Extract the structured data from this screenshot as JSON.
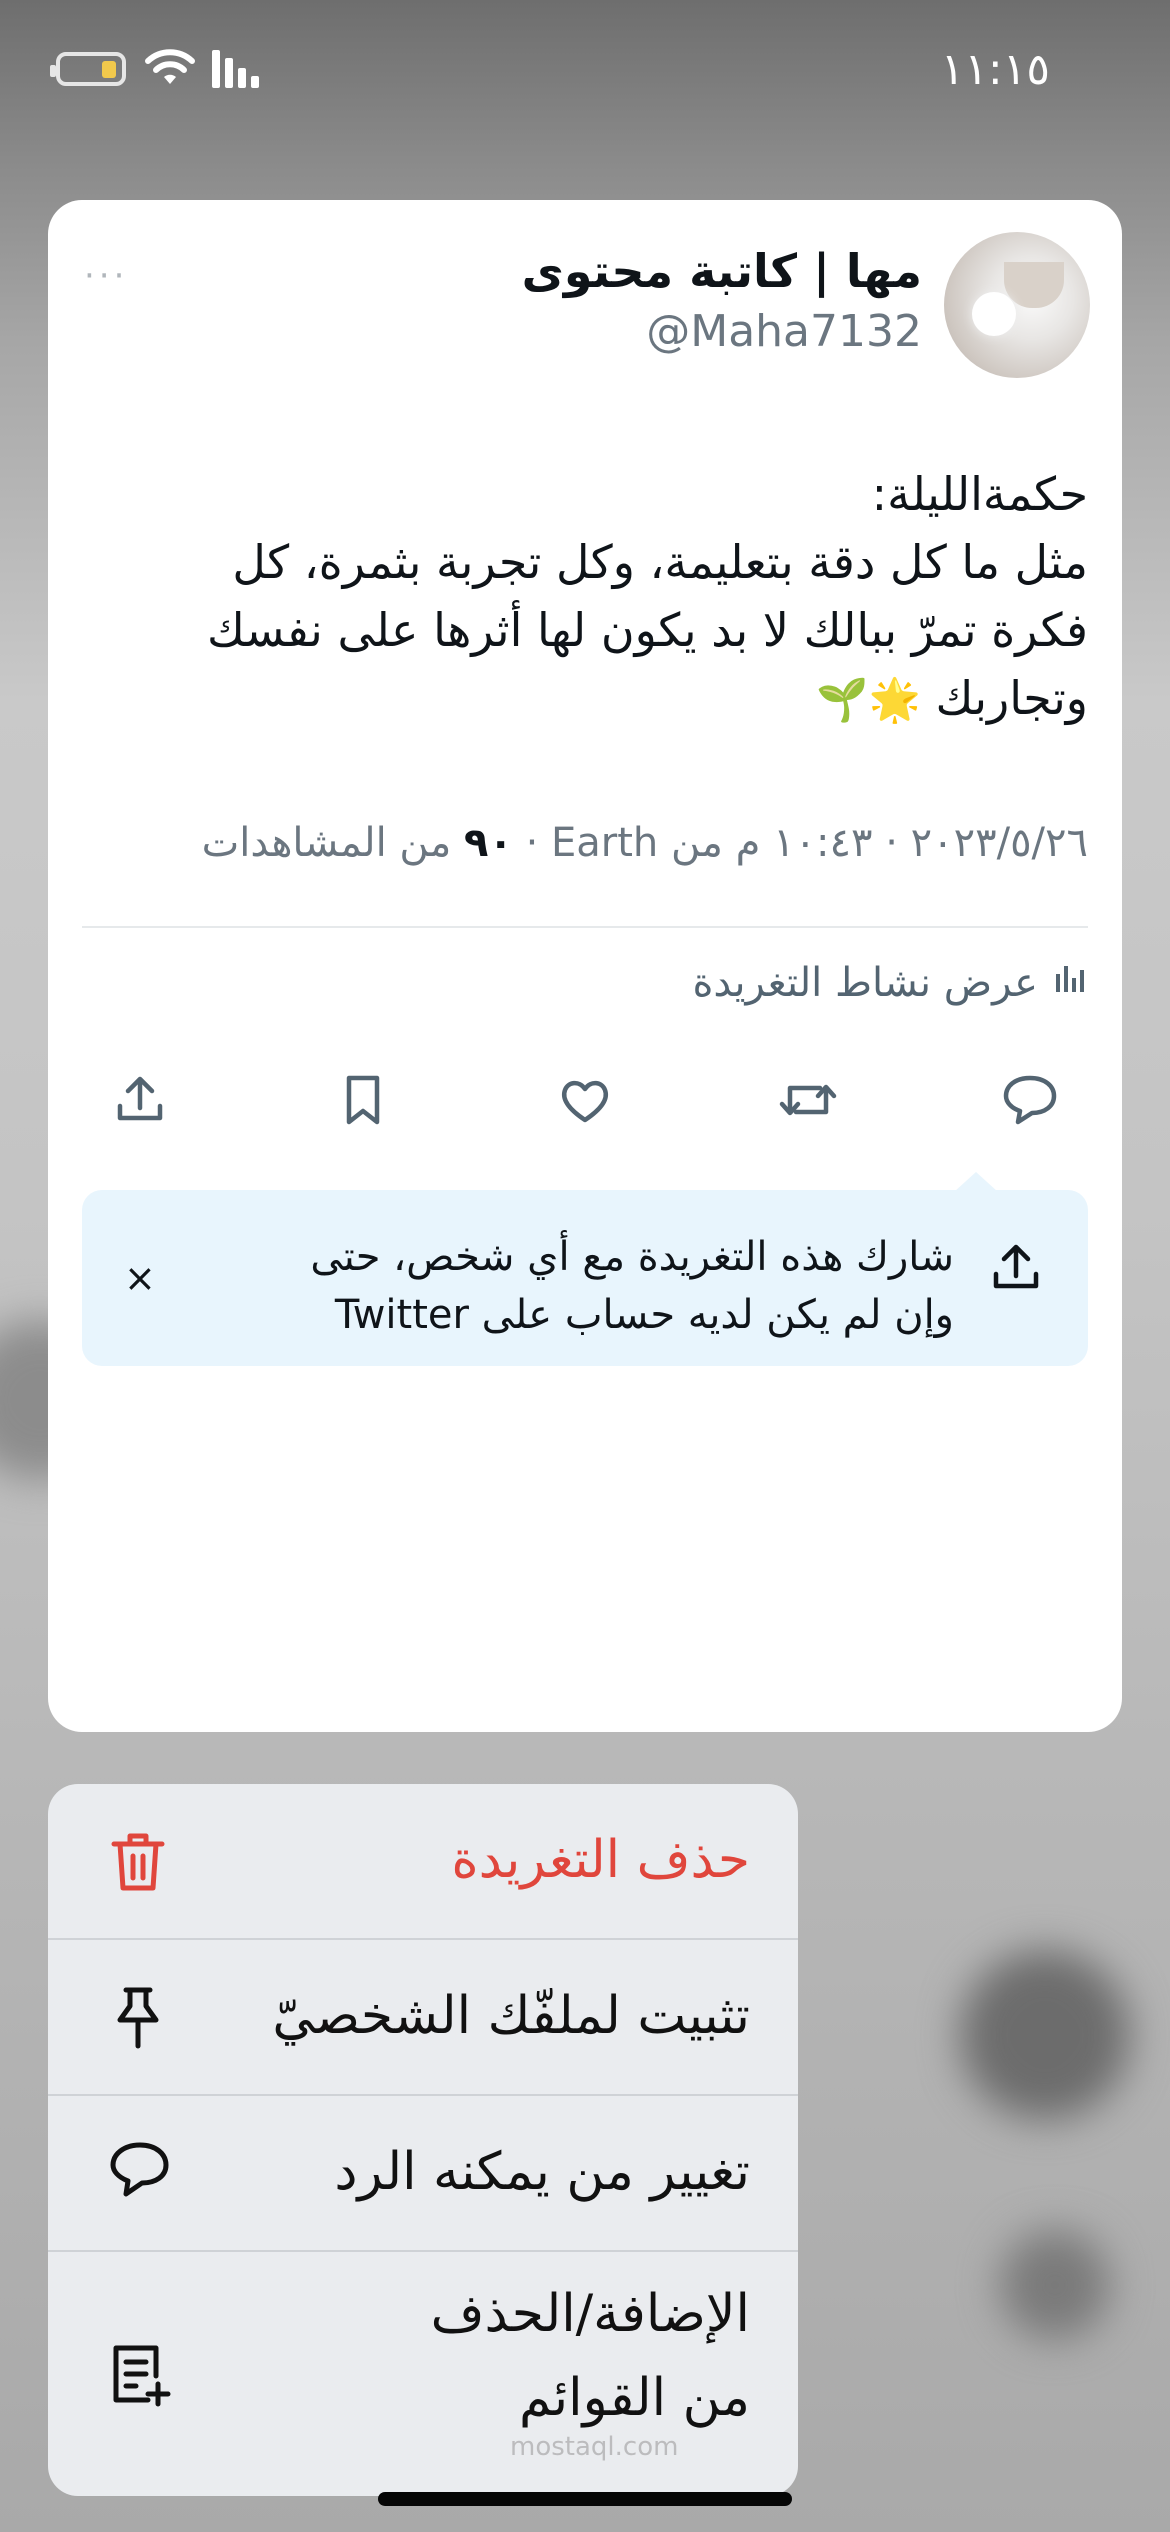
{
  "status_bar": {
    "time": "١١:١٥"
  },
  "tweet": {
    "author_name": "مها | كاتبة محتوى",
    "handle": "@Maha7132",
    "more": "···",
    "text": "حكمةالليلة:\nمثل ما كل دقة بتعليمة، وكل تجربة بثمرة، كل\nفكرة تمرّ ببالك لا بد يكون لها أثرها على نفسك\nوتجاربك",
    "emojis": "🌟🌱",
    "meta_prefix": "٢٠٢٣/٥/٢٦ · ١٠:٤٣ م من Earth · ",
    "views_count": "٩٠",
    "views_label": " من المشاهدات",
    "activity_label": "عرض نشاط التغريدة"
  },
  "share_tip": {
    "text": "شارك هذه التغريدة مع أي شخص، حتى\nوإن لم يكن لديه حساب على Twitter",
    "close": "×"
  },
  "menu": {
    "delete": "حذف التغريدة",
    "pin": "تثبيت لملفّك الشخصيّ",
    "reply_settings": "تغيير من يمكنه الرد",
    "lists": "الإضافة/الحذف\nمن القوائم"
  },
  "watermark": "mostaql.com",
  "colors": {
    "delete_red": "#e0463c",
    "accent_blue": "#1d9bf0"
  }
}
